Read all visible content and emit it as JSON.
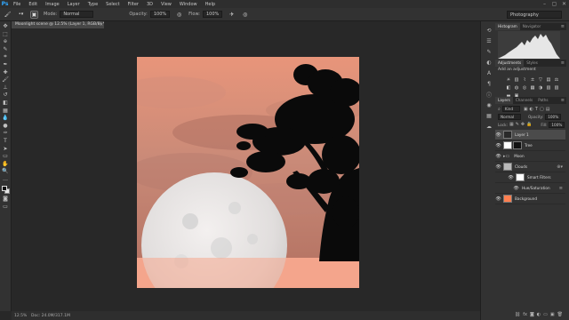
{
  "menubar": {
    "logo": "Ps",
    "items": [
      "File",
      "Edit",
      "Image",
      "Layer",
      "Type",
      "Select",
      "Filter",
      "3D",
      "View",
      "Window",
      "Help"
    ],
    "window_controls": [
      "–",
      "▢",
      "✕"
    ]
  },
  "options": {
    "mode_label": "Mode:",
    "mode_value": "Normal",
    "opacity_label": "Opacity:",
    "opacity_value": "100%",
    "flow_label": "Flow:",
    "flow_value": "100%",
    "workspace": "Photography"
  },
  "document": {
    "tab_title": "Moonlight scene @ 12.5% (Layer 1, RGB/8) *"
  },
  "status": {
    "zoom": "12.5%",
    "doc_size": "Doc: 24.0M/317.1M"
  },
  "panels": {
    "histogram_tabs": [
      "Histogram",
      "Navigator"
    ],
    "adjustments_tabs": [
      "Adjustments",
      "Styles"
    ],
    "adjustments_subtitle": "Add an adjustment",
    "layers_tabs": [
      "Layers",
      "Channels",
      "Paths"
    ]
  },
  "layers": {
    "filter": "Kind",
    "blend_mode": "Normal",
    "opacity_label": "Opacity:",
    "opacity_value": "100%",
    "lock_label": "Lock:",
    "fill_label": "Fill:",
    "fill_value": "100%",
    "items": [
      {
        "name": "Layer 1",
        "thumb_color": "#2a2a2a"
      },
      {
        "name": "Tree",
        "thumb_color": "#ffffff"
      },
      {
        "name": "Moon",
        "thumb_color": "#8a8a8a"
      },
      {
        "name": "Clouds",
        "thumb_color": "#b8b8b8"
      },
      {
        "name": "Smart Filters",
        "thumb_color": "#ffffff"
      },
      {
        "name": "Hue/Saturation",
        "thumb_color": ""
      },
      {
        "name": "Background",
        "thumb_color": "#ff7f50"
      }
    ]
  },
  "colors": {
    "accent": "#31a8ff",
    "sky_top": "#e8957a",
    "sky_bottom": "#b27060",
    "ground": "#f4a58c",
    "moon": "#e7e7e7",
    "tree": "#0a0a0a",
    "background_layer": "#ff7f50"
  }
}
